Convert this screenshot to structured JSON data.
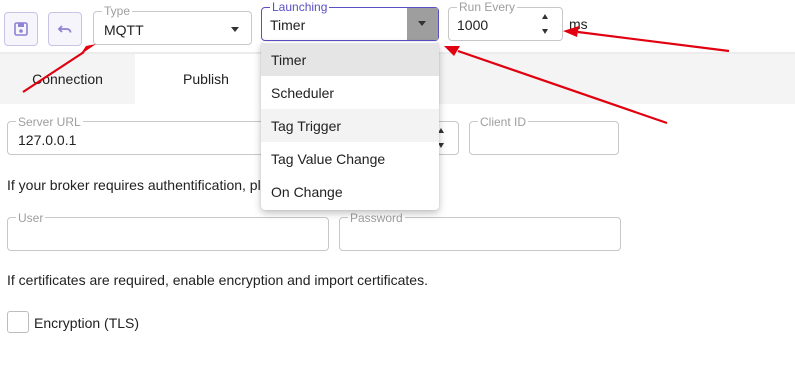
{
  "toolbar": {
    "save_icon": "floppy-disk-icon",
    "undo_icon": "undo-arrow-icon",
    "type": {
      "label": "Type",
      "value": "MQTT"
    },
    "launching": {
      "label": "Launching",
      "value": "Timer"
    },
    "run_every": {
      "label": "Run Every",
      "value": "1000",
      "unit": "ms"
    }
  },
  "tabs": [
    {
      "label": "Connection"
    },
    {
      "label": "Publish"
    }
  ],
  "launching_menu": {
    "options": [
      "Timer",
      "Scheduler",
      "Tag Trigger",
      "Tag Value Change",
      "On Change"
    ],
    "selected": "Timer"
  },
  "connection": {
    "server_url": {
      "label": "Server URL",
      "value": "127.0.0.1"
    },
    "client_id": {
      "label": "Client ID",
      "value": ""
    },
    "auth_text": "If your broker requires authentification, pl",
    "user": {
      "label": "User",
      "value": ""
    },
    "password": {
      "label": "Password",
      "value": ""
    },
    "cert_text": "If certificates are required, enable encryption and import certificates.",
    "encryption_label": "Encryption (TLS)"
  },
  "colors": {
    "accent": "#5b4fc4",
    "annotation_arrow": "#e0000f"
  }
}
